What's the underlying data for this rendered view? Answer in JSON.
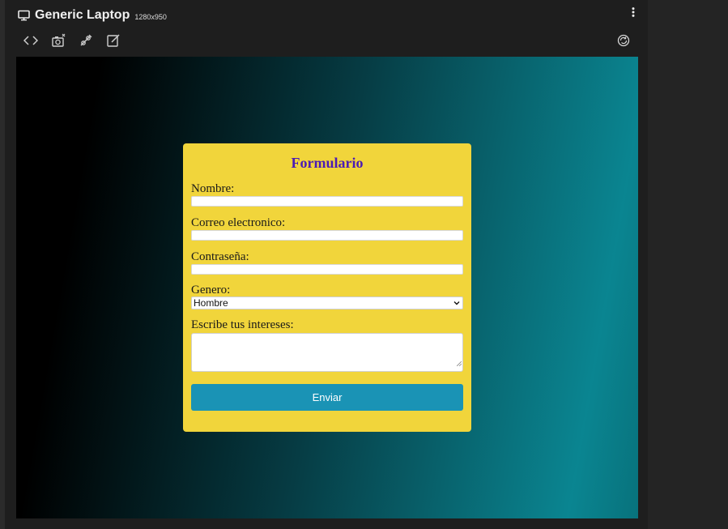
{
  "header": {
    "device_name": "Generic Laptop",
    "resolution": "1280x950",
    "icons": {
      "device": "monitor-icon",
      "more": "more-vertical-icon",
      "rotate": "rotate-icon"
    }
  },
  "toolbar": {
    "tools": [
      {
        "name": "code-icon"
      },
      {
        "name": "screenshot-icon"
      },
      {
        "name": "inspect-icon"
      },
      {
        "name": "edit-icon"
      }
    ]
  },
  "colors": {
    "app_background": "#1e1e1e",
    "card_background": "#f1d53b",
    "title_color": "#4b1bb5",
    "button_color": "#1a93b5",
    "gradient_start": "#000000",
    "gradient_end": "#0a8591"
  },
  "form": {
    "title": "Formulario",
    "fields": {
      "nombre_label": "Nombre:",
      "nombre_value": "",
      "correo_label": "Correo electronico:",
      "correo_value": "",
      "contrasena_label": "Contraseña:",
      "contrasena_value": "",
      "genero_label": "Genero:",
      "genero_selected": "Hombre",
      "intereses_label": "Escribe tus intereses:",
      "intereses_value": ""
    },
    "submit_label": "Enviar"
  }
}
